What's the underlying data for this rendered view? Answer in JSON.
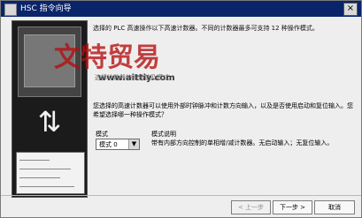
{
  "window": {
    "title": "HSC 指令向导",
    "close_glyph": "×"
  },
  "content": {
    "intro": "选择的 PLC 高速操作以下高速计数器。不同的计数器最多可支持 12 种操作模式。",
    "watermark_logo": "文特贸易",
    "watermark_url": "www.aittiy.com",
    "section_title": "选择计数器的初始值及模式",
    "description": "您选择的高速计数器可以使用外部时钟脉冲和计数方向输入，以及是否使用启动和复位输入。您希望选择哪一种操作模式？",
    "mode_label": "模式",
    "mode_value": "模式 0",
    "explain_label": "模式说明",
    "explain_text": "带有内部方向控制的单相增/减计数器。无启动输入；无复位输入。"
  },
  "buttons": {
    "prev": "< 上一步",
    "next": "下一步 >",
    "cancel": "取消"
  }
}
